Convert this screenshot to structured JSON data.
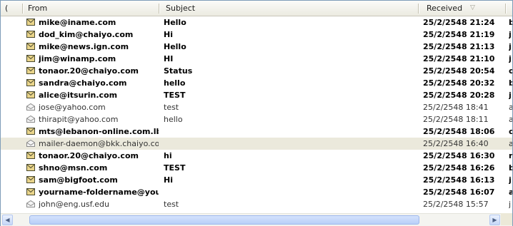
{
  "header": {
    "first_col": "(",
    "from": "From",
    "subject": "Subject",
    "received": "Received",
    "sort_icon": "sort-descending-icon"
  },
  "messages": [
    {
      "from": "mike@iname.com",
      "subject": "Hello",
      "received": "25/2/2548 21:24",
      "extra": "b",
      "state": "unread"
    },
    {
      "from": "dod_kim@chaiyo.com",
      "subject": "Hi",
      "received": "25/2/2548 21:19",
      "extra": "j",
      "state": "unread"
    },
    {
      "from": "mike@news.ign.com",
      "subject": "Hello",
      "received": "25/2/2548 21:13",
      "extra": "j",
      "state": "unread"
    },
    {
      "from": "jim@winamp.com",
      "subject": "HI",
      "received": "25/2/2548 21:10",
      "extra": "j",
      "state": "unread"
    },
    {
      "from": "tonaor.20@chaiyo.com",
      "subject": "Status",
      "received": "25/2/2548 20:54",
      "extra": "o",
      "state": "unread"
    },
    {
      "from": "sandra@chaiyo.com",
      "subject": "hello",
      "received": "25/2/2548 20:32",
      "extra": "b",
      "state": "unread"
    },
    {
      "from": "alice@itsurin.com",
      "subject": "TEST",
      "received": "25/2/2548 20:28",
      "extra": "j",
      "state": "unread"
    },
    {
      "from": "jose@yahoo.com",
      "subject": "test",
      "received": "25/2/2548 18:41",
      "extra": "a",
      "state": "read"
    },
    {
      "from": "thirapit@yahoo.com",
      "subject": "hello",
      "received": "25/2/2548 18:11",
      "extra": "a",
      "state": "read"
    },
    {
      "from": "mts@lebanon-online.com.lb",
      "subject": "",
      "received": "25/2/2548 18:06",
      "extra": "c",
      "state": "unread"
    },
    {
      "from": "mailer-daemon@bkk.chaiyo.com",
      "subject": "",
      "received": "25/2/2548 16:40",
      "extra": "a",
      "state": "read",
      "selected": true
    },
    {
      "from": "tonaor.20@chaiyo.com",
      "subject": "hi",
      "received": "25/2/2548 16:30",
      "extra": "n",
      "state": "unread"
    },
    {
      "from": "shno@msn.com",
      "subject": "TEST",
      "received": "25/2/2548 16:26",
      "extra": "b",
      "state": "unread"
    },
    {
      "from": "sam@bigfoot.com",
      "subject": "Hi",
      "received": "25/2/2548 16:13",
      "extra": "j",
      "state": "unread"
    },
    {
      "from": "yourname-foldername@you...",
      "subject": "",
      "received": "25/2/2548 16:07",
      "extra": "a",
      "state": "unread"
    },
    {
      "from": "john@eng.usf.edu",
      "subject": "test",
      "received": "25/2/2548 15:57",
      "extra": "j",
      "state": "read"
    }
  ],
  "scrollbar": {
    "left_icon": "scroll-left-arrow-icon",
    "right_icon": "scroll-right-arrow-icon"
  },
  "colors": {
    "selected_row": "#ebe9dc",
    "header_bg": "#ebeae0",
    "envelope_unread": "#e9d48a",
    "envelope_read": "#f4f4f4"
  }
}
